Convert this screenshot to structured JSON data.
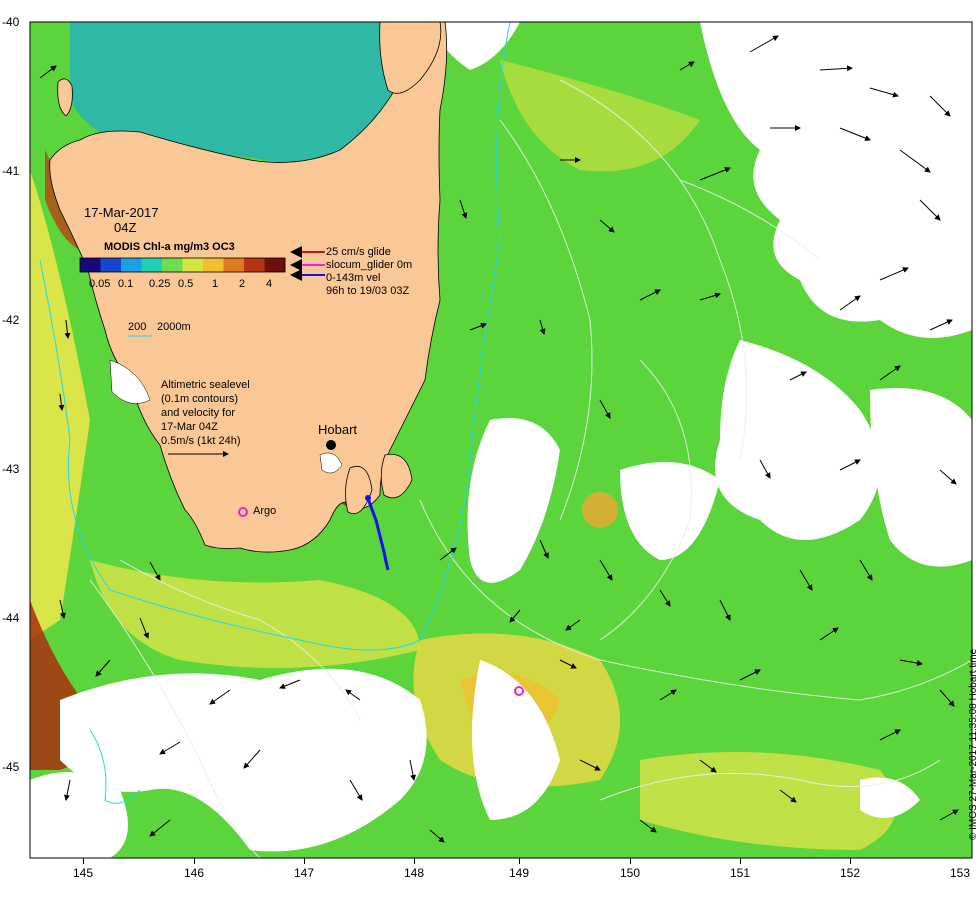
{
  "map": {
    "date": "17-Mar-2017",
    "time": "04Z",
    "colorbar_title": "MODIS Chl-a mg/m3 OC3",
    "colorbar_ticks": [
      "0.05",
      "0.1",
      "0.25",
      "0.5",
      "1",
      "2",
      "4"
    ],
    "colorbar_colors": [
      "#140a78",
      "#1846d2",
      "#1aa0e6",
      "#20d0b4",
      "#70dc50",
      "#d6e440",
      "#f0c030",
      "#e07a1e",
      "#b43414",
      "#6e1008"
    ],
    "legend_lines": [
      "25 cm/s glide",
      "slocum_glider 0m",
      "0-143m vel",
      "96h to 19/03 03Z"
    ],
    "legend_colors": [
      "#cc1111",
      "#ee22ee",
      "#1111ee"
    ],
    "contour_legend": {
      "shallow": "200",
      "deep": "2000m"
    },
    "sealevel_text": [
      "Altimetric sealevel",
      "(0.1m contours)",
      "and velocity for",
      "17-Mar 04Z",
      "0.5m/s (1kt 24h)"
    ],
    "place_labels": {
      "city": "Hobart",
      "argo": "Argo"
    },
    "credit": "© IMOS 27-Mar-2017 11:35:08 Hobart time",
    "lon_ticks": [
      "145",
      "146",
      "147",
      "148",
      "149",
      "150",
      "151",
      "152",
      "153"
    ],
    "lat_ticks": [
      "-40",
      "-41",
      "-42",
      "-43",
      "-44",
      "-45"
    ],
    "colors": {
      "land": "#fac896",
      "ocean_green": "#5cd43c",
      "ocean_teal": "#2fb8a4",
      "ocean_yellow": "#d8e448",
      "ocean_orange": "#f0c030",
      "coastal_brown": "#a8300c",
      "cloud": "#ffffff",
      "contour_shelf": "#22d8e8",
      "contour_sealevel": "#e8f0e8",
      "argo": "#ee22cc",
      "glider_track": "#1111ee"
    }
  }
}
